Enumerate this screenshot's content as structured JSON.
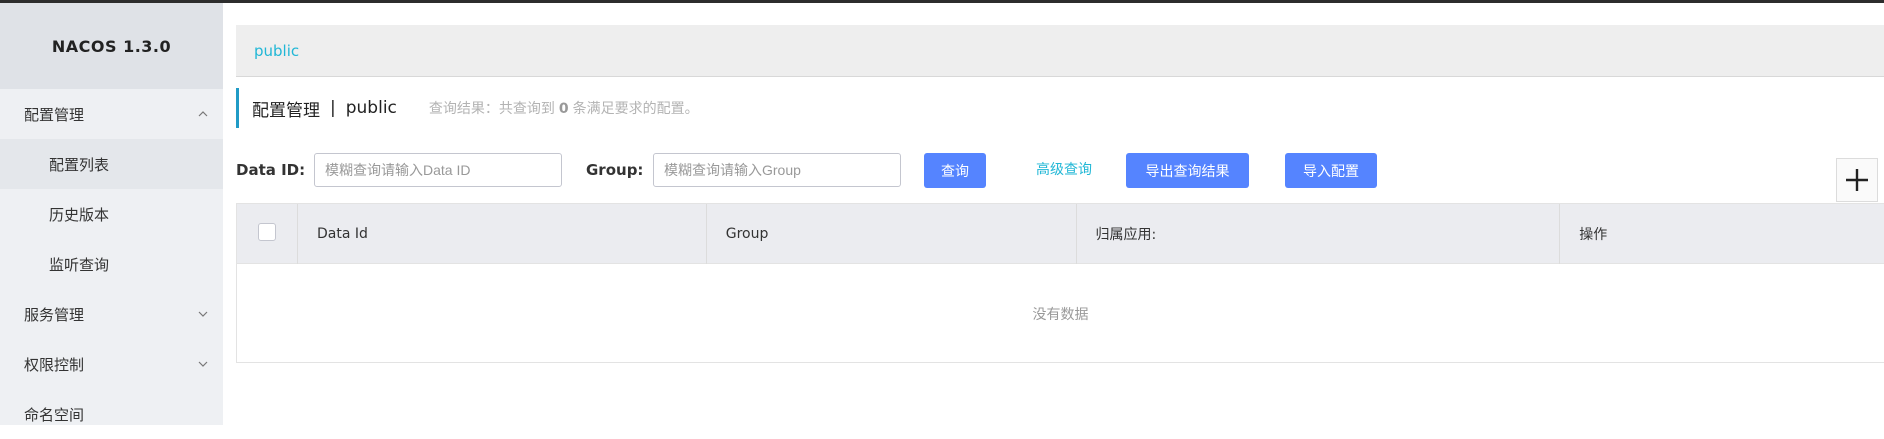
{
  "brand": {
    "title": "NACOS 1.3.0"
  },
  "sidebar": {
    "items": [
      {
        "label": "配置管理",
        "expanded": true,
        "children": [
          {
            "label": "配置列表",
            "active": true
          },
          {
            "label": "历史版本"
          },
          {
            "label": "监听查询"
          }
        ]
      },
      {
        "label": "服务管理",
        "expanded": false
      },
      {
        "label": "权限控制",
        "expanded": false
      },
      {
        "label": "命名空间"
      }
    ]
  },
  "namespace_bar": {
    "link": "public"
  },
  "page_title": {
    "title": "配置管理",
    "separator": "|",
    "namespace": "public",
    "result_prefix": "查询结果：共查询到",
    "result_count": "0",
    "result_suffix": "条满足要求的配置。"
  },
  "search": {
    "data_id_label": "Data ID:",
    "data_id_placeholder": "模糊查询请输入Data ID",
    "group_label": "Group:",
    "group_placeholder": "模糊查询请输入Group",
    "query_button": "查询",
    "advanced_link": "高级查询",
    "export_button": "导出查询结果",
    "import_button": "导入配置",
    "add_button": "+"
  },
  "table": {
    "columns": [
      "Data Id",
      "Group",
      "归属应用:",
      "操作"
    ],
    "empty_text": "没有数据"
  },
  "colors": {
    "primary_button": "#5584ff",
    "link": "#21b7d6",
    "accent_bar": "#209bc6",
    "sidebar_bg": "#eef0f3"
  }
}
